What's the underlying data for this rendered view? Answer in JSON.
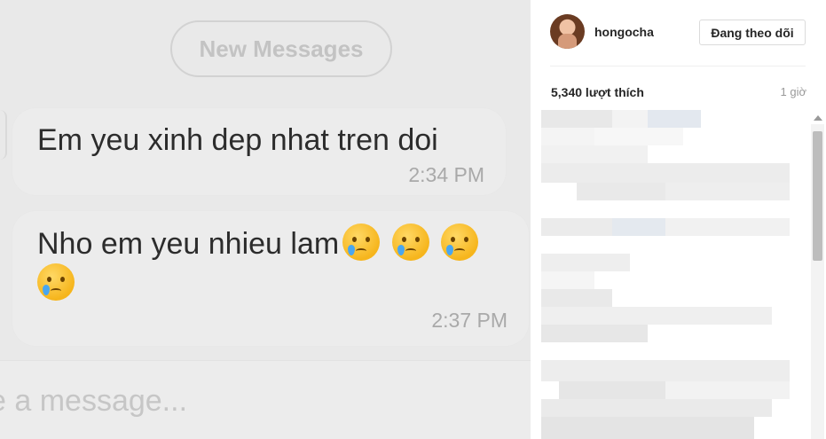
{
  "photo": {
    "pill_label": "New Messages",
    "messages": [
      {
        "text": "Em yeu xinh dep nhat tren doi",
        "time": "2:34 PM"
      },
      {
        "text": "Nho em yeu nhieu lam",
        "emoji_count": 4,
        "emoji": "crying-face",
        "time": "2:37 PM"
      }
    ],
    "compose_placeholder": "e a message..."
  },
  "post": {
    "username": "hongocha",
    "follow_label": "Đang theo dõi",
    "likes": "5,340 lượt thích",
    "time_ago": "1 giờ"
  },
  "colors": {
    "bubble": "#ececec",
    "photo_bg": "#e9e9e9",
    "text": "#262626",
    "muted": "#999999"
  }
}
